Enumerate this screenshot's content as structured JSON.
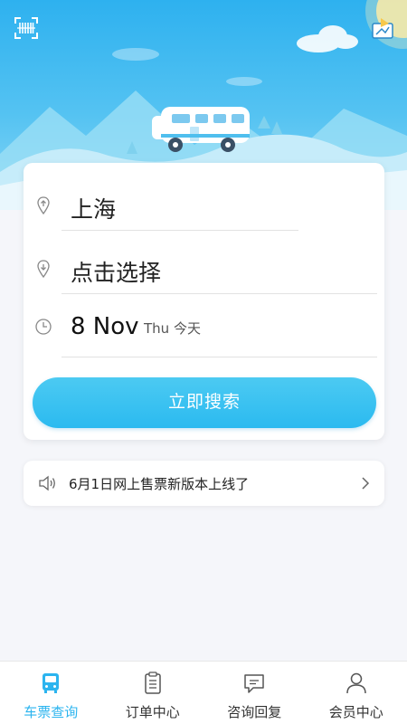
{
  "colors": {
    "accent": "#2bb4ef",
    "search_button": "#3cc2f1",
    "header_sky": "#2eb1ef"
  },
  "header": {
    "scan_icon": "barcode-scan-icon",
    "share_icon": "share-map-icon"
  },
  "search": {
    "from": {
      "icon": "location-pin-icon",
      "value": "上海"
    },
    "to": {
      "icon": "location-pin-icon",
      "value": "点击选择"
    },
    "date": {
      "icon": "clock-icon",
      "value": "8 Nov",
      "weekday": "Thu 今天"
    },
    "button_label": "立即搜索"
  },
  "notice": {
    "icon": "speaker-icon",
    "text": "6月1日网上售票新版本上线了",
    "chevron_icon": "chevron-right-icon"
  },
  "tabs": [
    {
      "label": "车票查询",
      "icon": "bus-icon",
      "active": true
    },
    {
      "label": "订单中心",
      "icon": "clipboard-icon",
      "active": false
    },
    {
      "label": "咨询回复",
      "icon": "chat-bubble-icon",
      "active": false
    },
    {
      "label": "会员中心",
      "icon": "person-icon",
      "active": false
    }
  ]
}
